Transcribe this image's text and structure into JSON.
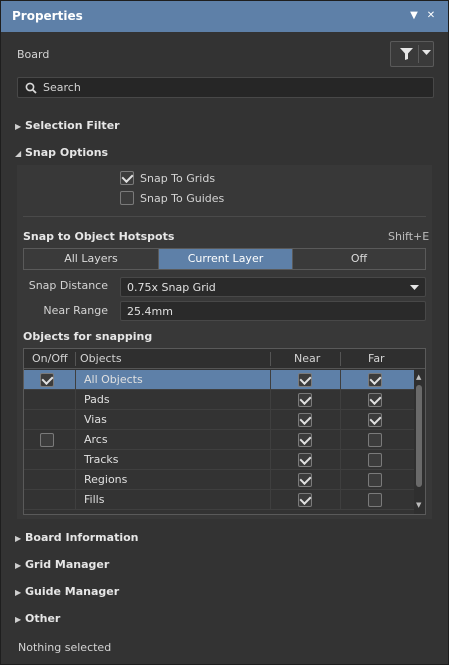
{
  "window": {
    "title": "Properties"
  },
  "header": {
    "context_label": "Board"
  },
  "search": {
    "placeholder": "Search"
  },
  "sections": {
    "selection_filter": "Selection Filter",
    "snap_options": "Snap Options",
    "board_information": "Board Information",
    "grid_manager": "Grid Manager",
    "guide_manager": "Guide Manager",
    "other": "Other"
  },
  "snap_options": {
    "snap_to_grids": {
      "label": "Snap To Grids",
      "checked": true
    },
    "snap_to_guides": {
      "label": "Snap To Guides",
      "checked": false
    },
    "hotspots_title": "Snap to Object Hotspots",
    "hotspots_shortcut": "Shift+E",
    "hotspot_modes": [
      "All Layers",
      "Current Layer",
      "Off"
    ],
    "hotspot_mode_selected": "Current Layer",
    "snap_distance_label": "Snap Distance",
    "snap_distance_value": "0.75x Snap Grid",
    "near_range_label": "Near Range",
    "near_range_value": "25.4mm",
    "objects_title": "Objects for snapping"
  },
  "objects_table": {
    "columns": [
      "On/Off",
      "Objects",
      "Near",
      "Far"
    ],
    "rows": [
      {
        "name": "All Objects",
        "onoff": true,
        "near": true,
        "far": true,
        "selected": true
      },
      {
        "name": "Pads",
        "onoff": null,
        "near": true,
        "far": true
      },
      {
        "name": "Vias",
        "onoff": null,
        "near": true,
        "far": true
      },
      {
        "name": "Arcs",
        "onoff": false,
        "near": true,
        "far": false
      },
      {
        "name": "Tracks",
        "onoff": null,
        "near": true,
        "far": false
      },
      {
        "name": "Regions",
        "onoff": null,
        "near": true,
        "far": false
      },
      {
        "name": "Fills",
        "onoff": null,
        "near": true,
        "far": false
      }
    ]
  },
  "status": {
    "text": "Nothing selected"
  },
  "colors": {
    "accent": "#5e80a8",
    "background": "#333333"
  }
}
